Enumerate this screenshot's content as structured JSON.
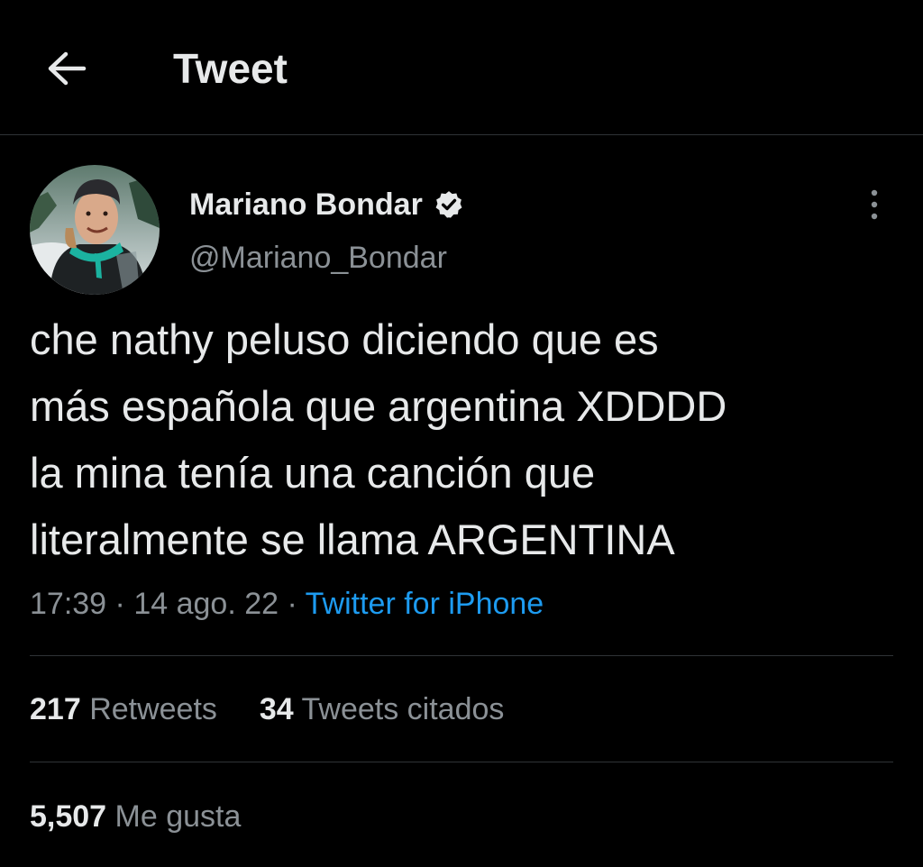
{
  "header": {
    "title": "Tweet",
    "back_icon": "arrow-left-icon"
  },
  "author": {
    "name": "Mariano Bondar",
    "handle": "@Mariano_Bondar",
    "verified_icon": "verified-badge-icon"
  },
  "tweet": {
    "lines": [
      "che nathy peluso diciendo que es",
      "más española que argentina XDDDD",
      "la mina tenía una canción que",
      "literalmente se llama ARGENTINA"
    ],
    "time": "17:39",
    "date": "14 ago. 22",
    "separator": "·",
    "source": "Twitter for iPhone"
  },
  "stats": {
    "retweets_count": "217",
    "retweets_label": "Retweets",
    "quotes_count": "34",
    "quotes_label": "Tweets citados",
    "likes_count": "5,507",
    "likes_label": "Me gusta"
  },
  "colors": {
    "background": "#000000",
    "text_primary": "#e7e9ea",
    "text_secondary": "#8b9196",
    "link": "#1d9bf0",
    "divider": "#2f3336"
  }
}
